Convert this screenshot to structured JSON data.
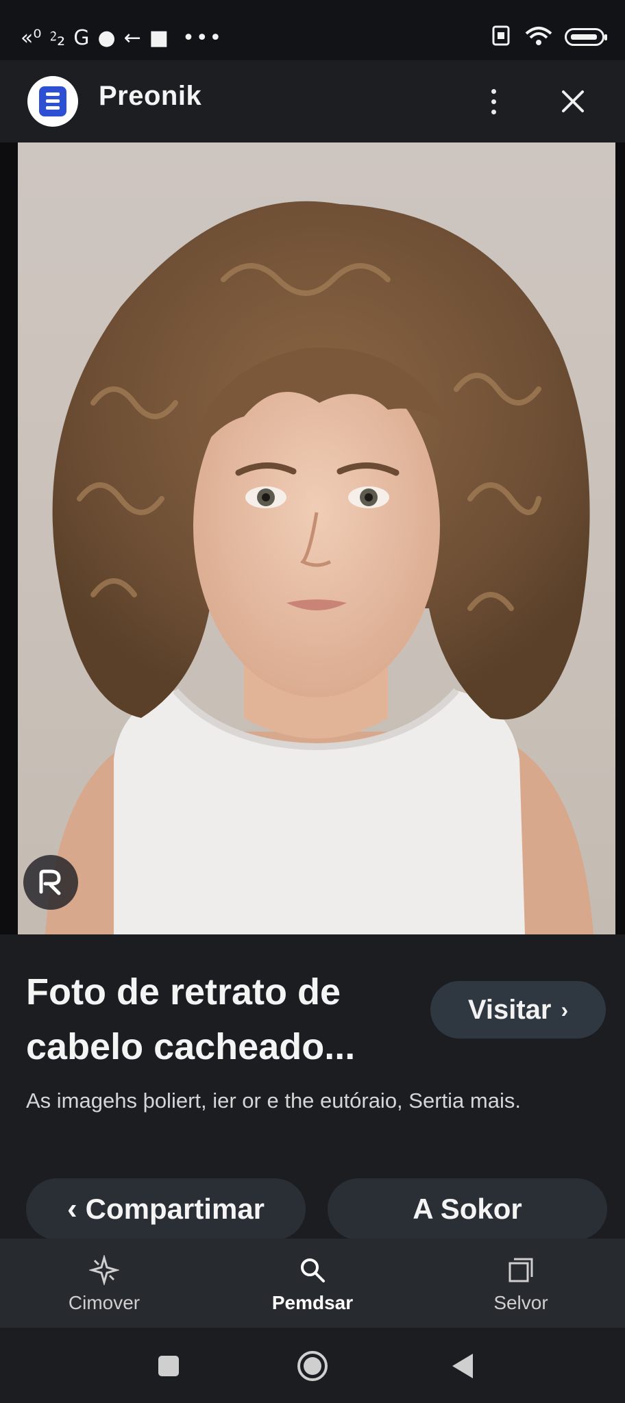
{
  "status_bar": {
    "left_symbols": [
      "«⁰",
      "⁲₂",
      "G",
      "●",
      "←",
      "■"
    ],
    "overflow": "•••",
    "battery_icon": "battery-icon",
    "wifi_icon": "wifi-icon",
    "sim_icon": "sim-icon"
  },
  "header": {
    "app_name": "Preonik",
    "logo_icon": "app-logo-icon",
    "more_icon": "more-vertical-icon",
    "close_icon": "close-icon"
  },
  "image": {
    "lens_icon": "visual-search-icon",
    "background_color": "#cdc5bf"
  },
  "result": {
    "title_line1": "Foto de retrato de",
    "title_line2": "cabelo cacheado...",
    "visit_label": "Visitar",
    "visit_chevron": "›",
    "description": "As imagehs þoliert, ier or e the eutóraio, Sertia mais.",
    "share_label": "Compartimar",
    "share_chevron": "‹",
    "save_label": "A Sokor"
  },
  "bottom_nav": {
    "items": [
      {
        "label": "Cimover",
        "icon": "discover-sparkle-icon"
      },
      {
        "label": "Pemdsar",
        "icon": "search-icon"
      },
      {
        "label": "Selvor",
        "icon": "collections-icon"
      }
    ],
    "active_index": 1
  },
  "system_nav": {
    "recents_icon": "square-icon",
    "home_icon": "home-circle-icon",
    "back_icon": "back-triangle-icon"
  },
  "colors": {
    "background": "#1b1d21",
    "header": "#1c1e22",
    "status_bar": "#121316",
    "button": "#2a2f36",
    "visit_button": "#2f3741",
    "text_primary": "#f4f4f4",
    "text_secondary": "#d6d6d6",
    "logo_blue": "#2c4fd4"
  }
}
